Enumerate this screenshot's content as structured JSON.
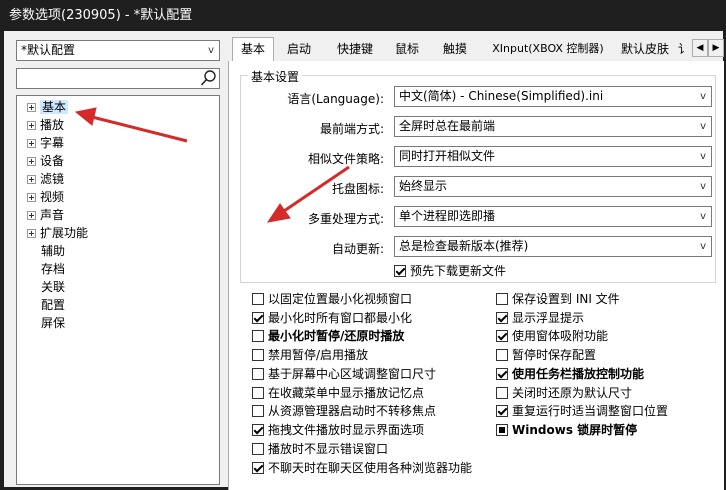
{
  "window": {
    "title": "参数选项(230905) - *默认配置"
  },
  "profile_combo": {
    "value": "*默认配置"
  },
  "search": {
    "placeholder": ""
  },
  "tree": {
    "expandable": [
      "基本",
      "播放",
      "字幕",
      "设备",
      "滤镜",
      "视频",
      "声音",
      "扩展功能"
    ],
    "leaves": [
      "辅助",
      "存档",
      "关联",
      "配置",
      "屏保"
    ],
    "selected": "基本"
  },
  "tabs": [
    "基本",
    "启动",
    "快捷键",
    "鼠标",
    "触摸",
    "XInput(XBOX 控制器)",
    "默认皮肤",
    "讠"
  ],
  "active_tab": "基本",
  "basic_settings": {
    "group_label": "基本设置",
    "rows": [
      {
        "label": "语言(Language):",
        "value": "中文(简体) - Chinese(Simplified).ini"
      },
      {
        "label": "最前端方式:",
        "value": "全屏时总在最前端"
      },
      {
        "label": "相似文件策略:",
        "value": "同时打开相似文件"
      },
      {
        "label": "托盘图标:",
        "value": "始终显示"
      },
      {
        "label": "多重处理方式:",
        "value": "单个进程即选即播"
      },
      {
        "label": "自动更新:",
        "value": "总是检查最新版本(推荐)"
      }
    ],
    "predownload": {
      "label": "预先下载更新文件",
      "checked": true
    }
  },
  "options_left": [
    {
      "label": "以固定位置最小化视频窗口",
      "state": "unchecked",
      "bold": false
    },
    {
      "label": "最小化时所有窗口都最小化",
      "state": "checked",
      "bold": false
    },
    {
      "label": "最小化时暂停/还原时播放",
      "state": "unchecked",
      "bold": true
    },
    {
      "label": "禁用暂停/启用播放",
      "state": "unchecked",
      "bold": false
    },
    {
      "label": "基于屏幕中心区域调整窗口尺寸",
      "state": "unchecked",
      "bold": false
    },
    {
      "label": "在收藏菜单中显示播放记忆点",
      "state": "unchecked",
      "bold": false
    },
    {
      "label": "从资源管理器启动时不转移焦点",
      "state": "unchecked",
      "bold": false
    },
    {
      "label": "拖拽文件播放时显示界面选项",
      "state": "checked",
      "bold": false
    },
    {
      "label": "播放时不显示错误窗口",
      "state": "unchecked",
      "bold": false
    },
    {
      "label": "不聊天时在聊天区使用各种浏览器功能",
      "state": "checked",
      "bold": false
    }
  ],
  "options_right": [
    {
      "label": "保存设置到 INI 文件",
      "state": "unchecked",
      "bold": false
    },
    {
      "label": "显示浮显提示",
      "state": "checked",
      "bold": false
    },
    {
      "label": "使用窗体吸附功能",
      "state": "checked",
      "bold": false
    },
    {
      "label": "暂停时保存配置",
      "state": "unchecked",
      "bold": false
    },
    {
      "label": "使用任务栏播放控制功能",
      "state": "checked",
      "bold": true
    },
    {
      "label": "关闭时还原为默认尺寸",
      "state": "unchecked",
      "bold": false
    },
    {
      "label": "重复运行时适当调整窗口位置",
      "state": "checked",
      "bold": false
    },
    {
      "label": "Windows 锁屏时暂停",
      "state": "indeterminate",
      "bold": true
    }
  ],
  "annotation_color": "#d42a2a"
}
